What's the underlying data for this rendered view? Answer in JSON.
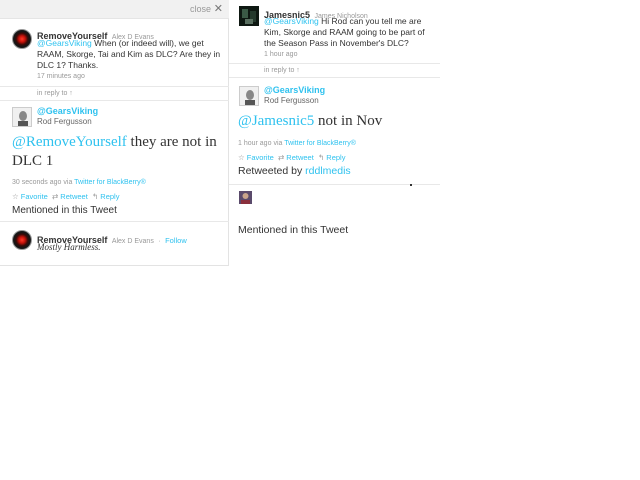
{
  "left": {
    "close_label": "close",
    "close_icon": "✕",
    "tweet1": {
      "username": "RemoveYourself",
      "realname": "Alex D Evans",
      "mention": "@GearsViking",
      "text": " When (or indeed will), we get RAAM, Skorge, Tai and Kim as DLC? Are they in DLC 1? Thanks.",
      "time": "17 minutes ago"
    },
    "in_reply_to": "in reply to ↑",
    "main_tweet": {
      "username": "@GearsViking",
      "realname": "Rod Fergusson",
      "mention": "@RemoveYourself",
      "text": " they are not in DLC 1",
      "time": "30 seconds ago",
      "via_prefix": "via",
      "via_link": "Twitter for BlackBerry®",
      "favorite": "Favorite",
      "retweet": "Retweet",
      "reply": "Reply",
      "mentioned": "Mentioned in this Tweet"
    },
    "mentioned_user": {
      "username": "RemoveYourself",
      "realname": "Alex D Evans",
      "dash": "·",
      "follow": "Follow",
      "bio": "Mostly Harmless."
    }
  },
  "right": {
    "tweet1": {
      "username": "Jamesnic5",
      "realname": "James Nicholson",
      "mention": "@GearsViking",
      "text": " Hi Rod can you tell me are Kim, Skorge and RAAM going to be part of the Season Pass in November's DLC?",
      "time": "1 hour ago"
    },
    "in_reply_to": "in reply to ↑",
    "main_tweet": {
      "username": "@GearsViking",
      "realname": "Rod Fergusson",
      "mention": "@Jamesnic5",
      "text": " not in Nov",
      "time": "1 hour ago",
      "via_prefix": "via",
      "via_link": "Twitter for BlackBerry®",
      "favorite": "Favorite",
      "retweet": "Retweet",
      "reply": "Reply",
      "retweeted_prefix": "Retweeted by",
      "retweeted_user": "rddlmedis",
      "mentioned": "Mentioned in this Tweet"
    }
  },
  "icons": {
    "star": "☆",
    "retweet": "⇄",
    "reply": "↰"
  }
}
